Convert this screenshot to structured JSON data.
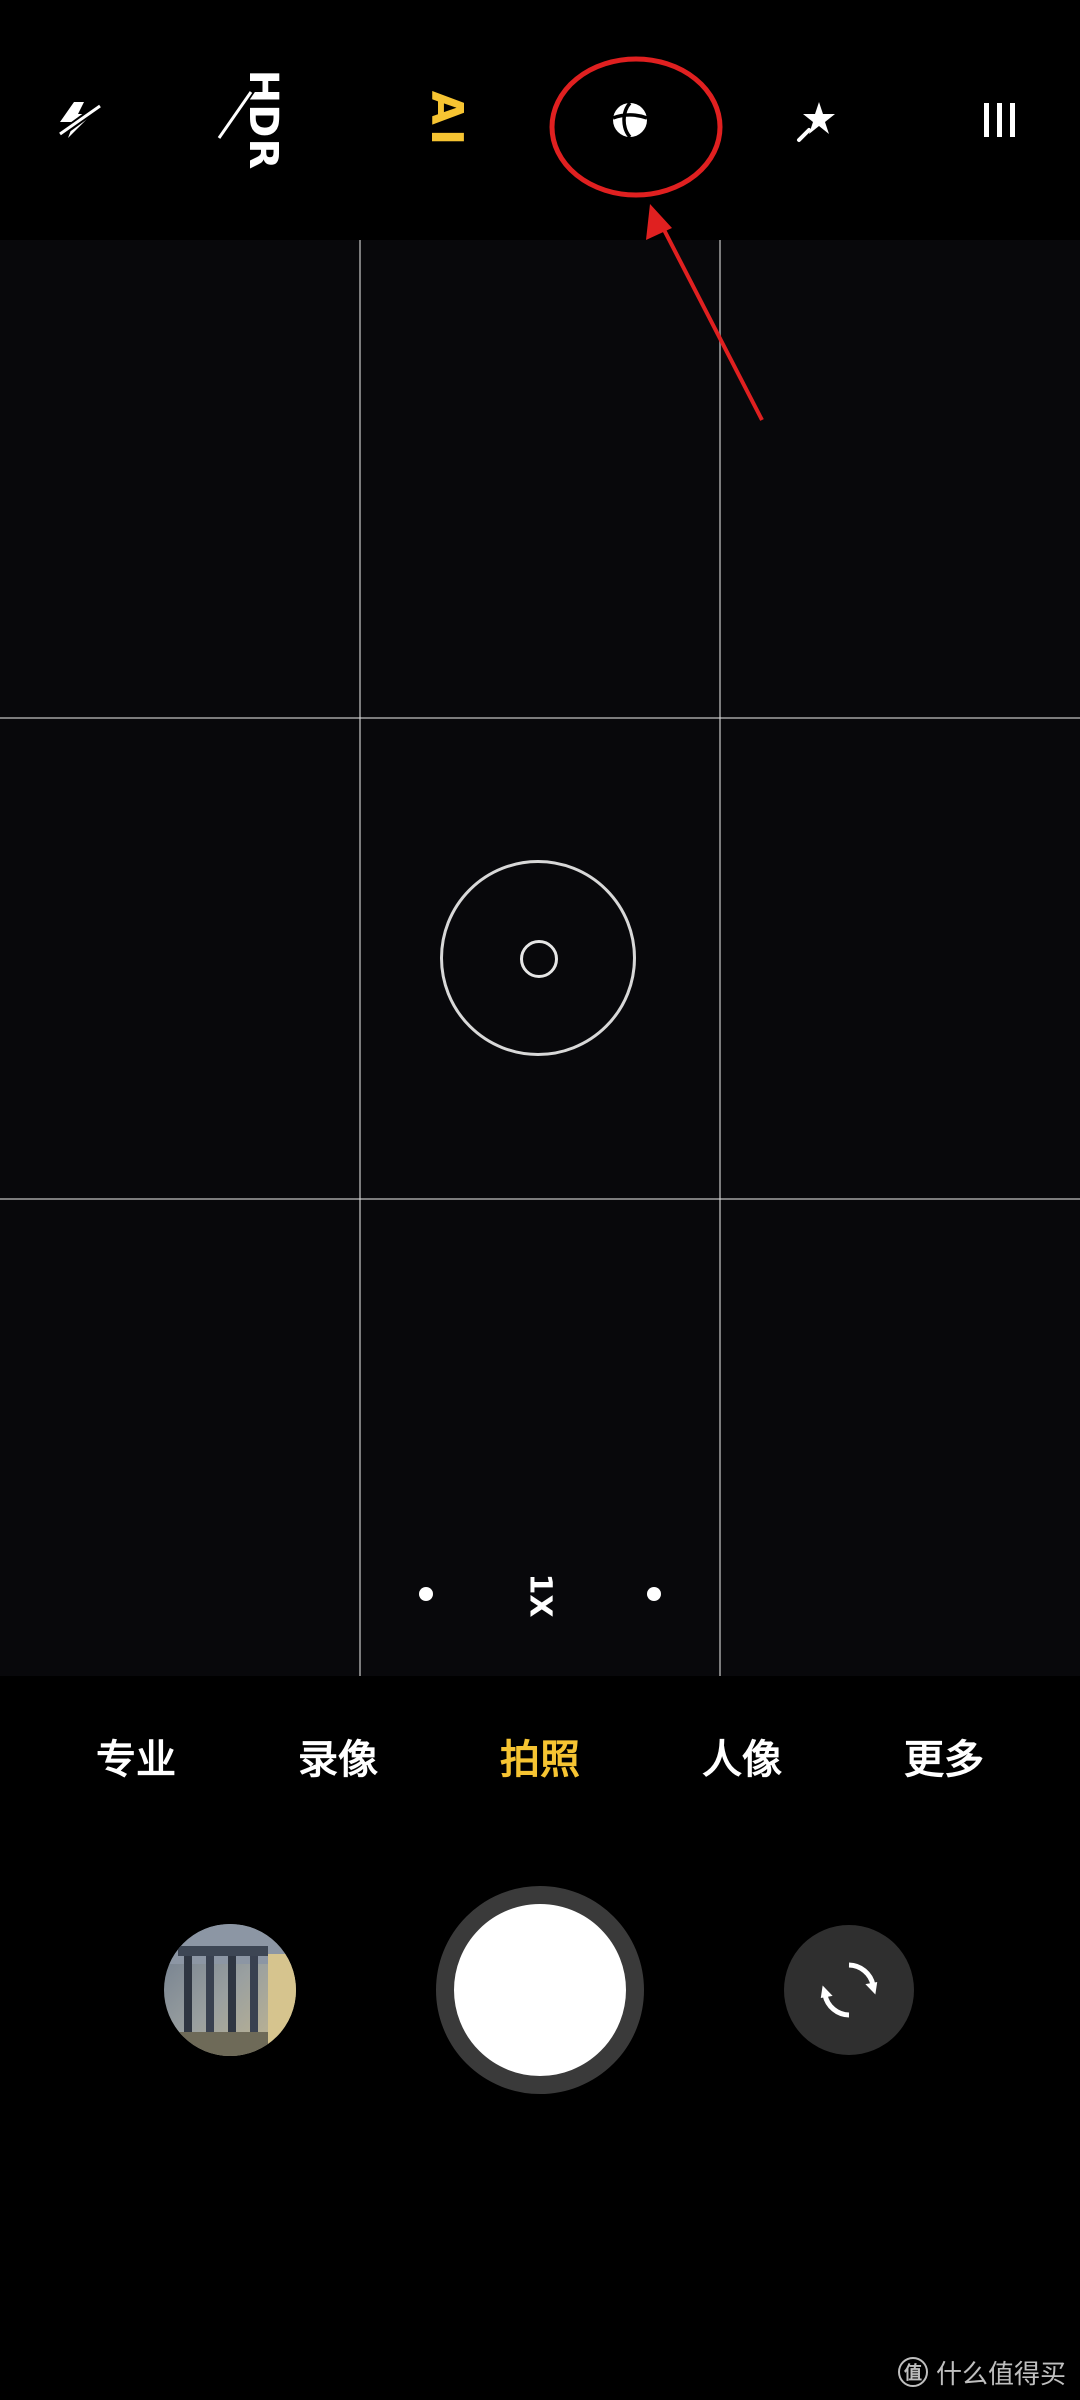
{
  "top_bar": {
    "icons": {
      "flash": "flash-off-icon",
      "filter": "filter-icon",
      "beauty": "beauty-sparkle-icon",
      "menu": "settings-menu-icon"
    },
    "hdr_label": "HDR",
    "ai_label": "AI"
  },
  "viewfinder": {
    "zoom_level": "1X"
  },
  "modes": {
    "items": [
      {
        "label": "专业"
      },
      {
        "label": "录像"
      },
      {
        "label": "拍照"
      },
      {
        "label": "人像"
      },
      {
        "label": "更多"
      }
    ],
    "active": "拍照"
  },
  "bottom": {
    "icons": {
      "gallery": "gallery-thumbnail",
      "shutter": "shutter-button",
      "switch": "switch-camera-icon"
    }
  },
  "watermark": {
    "text": "什么值得买",
    "badge": "值"
  },
  "colors": {
    "accent": "#f6c432",
    "annotation": "#e02020",
    "background": "#000000",
    "viewfinder": "#08080b"
  }
}
